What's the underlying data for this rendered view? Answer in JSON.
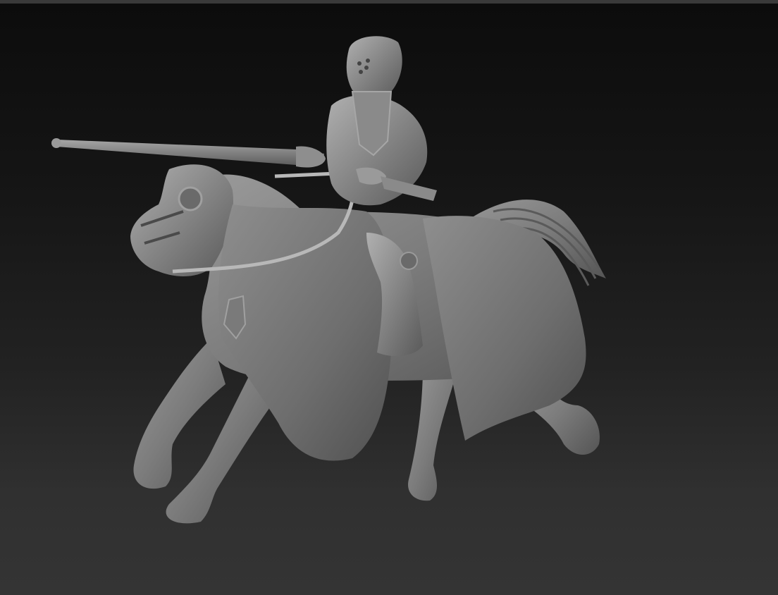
{
  "viewport": {
    "background_top": "#0c0c0c",
    "background_bottom": "#343434",
    "border_color": "#3a3a3a"
  },
  "model": {
    "material_base": "#7a7a7a",
    "material_highlight": "#a8a8a8",
    "material_shadow": "#4a4a4a"
  }
}
